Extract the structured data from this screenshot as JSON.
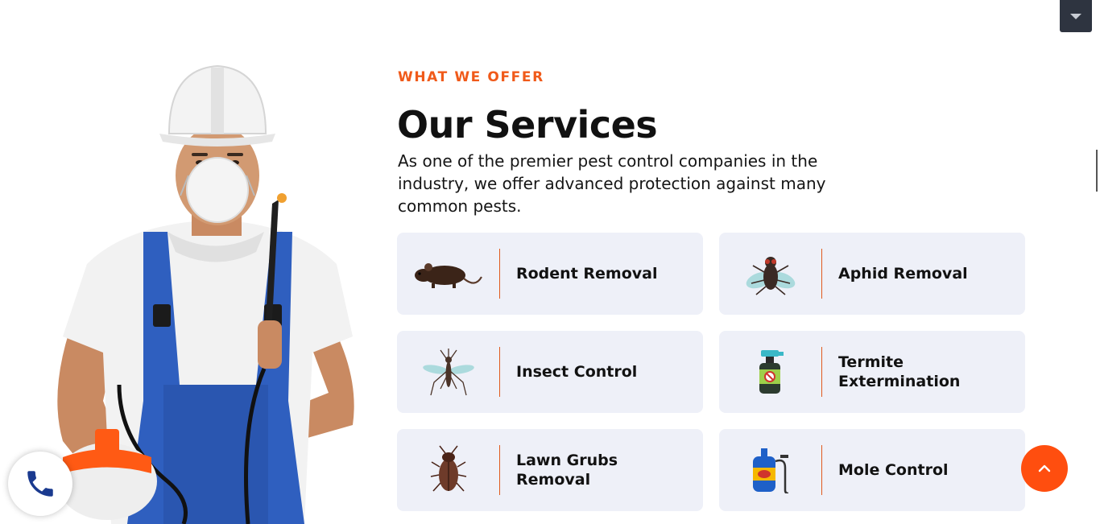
{
  "header": {
    "dropdown_icon": "caret-down-icon"
  },
  "services": {
    "eyebrow": "WHAT WE OFFER",
    "title": "Our Services",
    "description": "As one of the premier pest control companies in the industry, we offer advanced protection against many common pests.",
    "items": [
      {
        "label": "Rodent Removal",
        "icon": "rat-icon"
      },
      {
        "label": "Aphid Removal",
        "icon": "fly-icon"
      },
      {
        "label": "Insect Control",
        "icon": "mosquito-icon"
      },
      {
        "label": "Termite Extermination",
        "icon": "spray-bottle-icon"
      },
      {
        "label": "Lawn Grubs Removal",
        "icon": "cockroach-icon"
      },
      {
        "label": "Mole Control",
        "icon": "pump-sprayer-icon"
      }
    ]
  },
  "floating": {
    "call_icon": "phone-icon",
    "scroll_top_icon": "chevron-up-icon"
  },
  "colors": {
    "accent": "#f05a1a",
    "card_bg": "#eef0f8",
    "scroll_top_bg": "#ff4e0f",
    "phone_blue": "#1a3a8f"
  }
}
